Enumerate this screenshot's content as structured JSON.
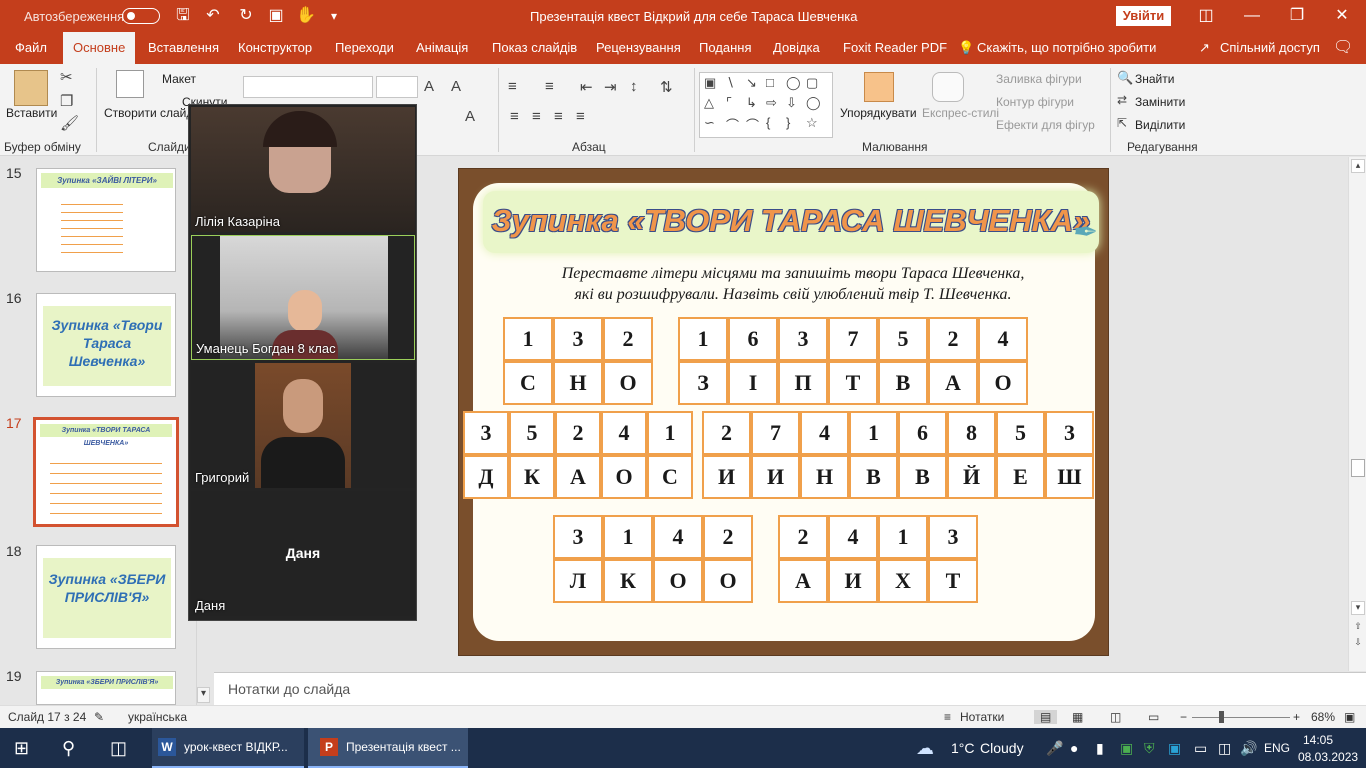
{
  "titlebar": {
    "autosave_label": "Автозбереження",
    "autosave_state": "Вимк.",
    "doc_title": "Презентація квест Відкрий для себе Тараса Шевченка",
    "signin_button": "Увійти"
  },
  "ribbon_tabs": [
    "Файл",
    "Основне",
    "Вставлення",
    "Конструктор",
    "Переходи",
    "Анімація",
    "Показ слайдів",
    "Рецензування",
    "Подання",
    "Довідка",
    "Foxit Reader PDF"
  ],
  "ribbon_active_tab": "Основне",
  "tell_me": "Скажіть, що потрібно зробити",
  "share": "Спільний доступ",
  "ribbon": {
    "paste": "Вставити",
    "clipboard_group": "Буфер обміну",
    "new_slide": "Створити слайд",
    "layout": "Макет",
    "reset": "Скинути",
    "slides_group": "Слайди",
    "paragraph_group": "Абзац",
    "arrange": "Упорядкувати",
    "quick_styles": "Експрес-стилі",
    "shape_fill": "Заливка фігури",
    "shape_outline": "Контур фігури",
    "shape_effects": "Ефекти для фігур",
    "drawing_group": "Малювання",
    "find": "Знайти",
    "replace": "Замінити",
    "select": "Виділити",
    "editing_group": "Редагування"
  },
  "thumbnails": [
    {
      "num": "15",
      "title": "Зупинка «ЗАЙВІ ЛІТЕРИ»"
    },
    {
      "num": "16",
      "title": "Зупинка «Твори Тараса Шевченка»"
    },
    {
      "num": "17",
      "title": "Зупинка «ТВОРИ ТАРАСА ШЕВЧЕНКА»"
    },
    {
      "num": "18",
      "title": "Зупинка «ЗБЕРИ ПРИСЛІВ'Я»"
    },
    {
      "num": "19",
      "title": "Зупинка «ЗБЕРИ ПРИСЛІВ'Я»"
    }
  ],
  "selected_thumbnail": "17",
  "video_call": [
    {
      "name": "Лілія Казаріна"
    },
    {
      "name": "Уманець Богдан 8 клас"
    },
    {
      "name": "Григорий"
    },
    {
      "name": "Даня",
      "center_label": "Даня"
    }
  ],
  "slide": {
    "title": "Зупинка «ТВОРИ ТАРАСА ШЕВЧЕНКА»",
    "instruction_line1": "Переставте літери місцями та запишіть твори Тараса Шевченка,",
    "instruction_line2": "які ви розшифрували. Назвіть свій улюблений твір Т. Шевченка.",
    "puzzles": [
      {
        "numbers": [
          "1",
          "3",
          "2"
        ],
        "letters": [
          "С",
          "Н",
          "О"
        ]
      },
      {
        "numbers": [
          "1",
          "6",
          "3",
          "7",
          "5",
          "2",
          "4"
        ],
        "letters": [
          "З",
          "І",
          "П",
          "Т",
          "В",
          "А",
          "О"
        ]
      },
      {
        "numbers": [
          "3",
          "5",
          "2",
          "4",
          "1"
        ],
        "letters": [
          "Д",
          "К",
          "А",
          "О",
          "С"
        ]
      },
      {
        "numbers": [
          "2",
          "7",
          "4",
          "1",
          "6",
          "8",
          "5",
          "3"
        ],
        "letters": [
          "И",
          "И",
          "Н",
          "В",
          "В",
          "Й",
          "Е",
          "Ш"
        ]
      },
      {
        "numbers": [
          "3",
          "1",
          "4",
          "2"
        ],
        "letters": [
          "Л",
          "К",
          "О",
          "О"
        ]
      },
      {
        "numbers": [
          "2",
          "4",
          "1",
          "3"
        ],
        "letters": [
          "А",
          "И",
          "Х",
          "Т"
        ]
      }
    ]
  },
  "notes_placeholder": "Нотатки до слайда",
  "status": {
    "slide_counter": "Слайд 17 з 24",
    "language": "українська",
    "notes_button": "Нотатки",
    "zoom": "68%"
  },
  "taskbar": {
    "apps": [
      {
        "label": "урок-квест ВІДКР..."
      },
      {
        "label": "Презентація квест ..."
      }
    ],
    "weather_temp": "1°C",
    "weather_desc": "Cloudy",
    "lang": "ENG",
    "time": "14:05",
    "date": "08.03.2023"
  },
  "colors": {
    "accent": "#c43e1c",
    "taskbar": "#1c2e4a",
    "cell_border": "#f0a04b",
    "frame": "#7a4f2c"
  }
}
